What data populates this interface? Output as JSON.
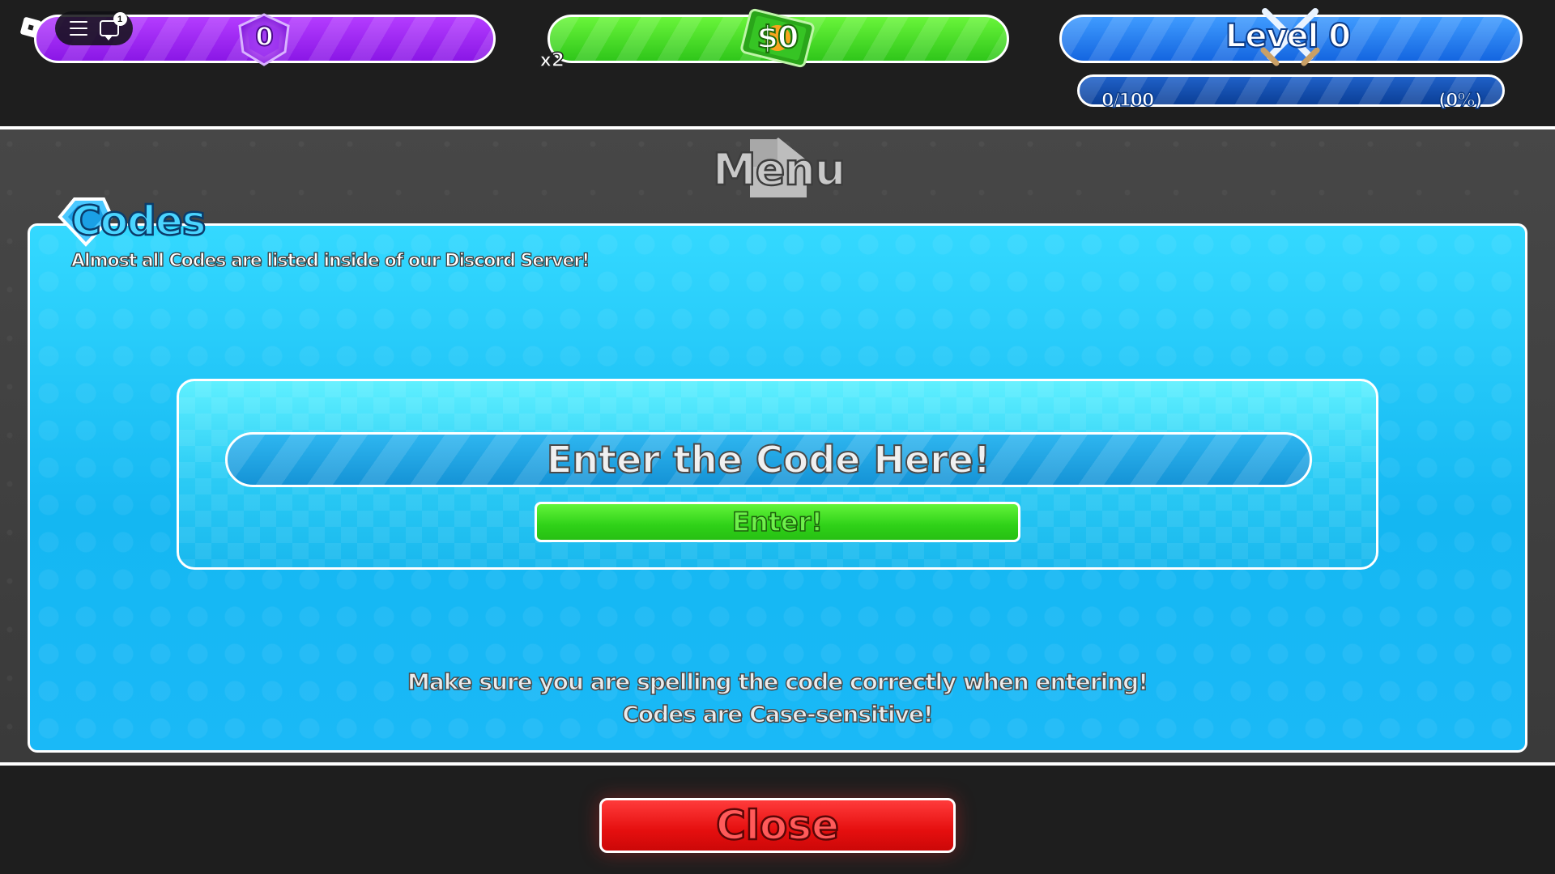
{
  "hud": {
    "gems": {
      "value": "0",
      "color": "#9b27f2"
    },
    "cash": {
      "value": "$0",
      "multiplier": "x2",
      "color": "#3fd624"
    },
    "level": {
      "label": "Level 0",
      "xp_text": "0/100",
      "xp_percent_text": "(0%)",
      "xp_progress": 0,
      "color": "#2a7ff0"
    },
    "chat_badge": "1"
  },
  "menu": {
    "title": "Menu"
  },
  "codes": {
    "title": "Codes",
    "subtitle": "Almost all Codes are listed inside of our Discord Server!",
    "input_placeholder": "Enter the Code Here!",
    "enter_label": "Enter!",
    "warning_line1": "Make sure you are spelling the code correctly when entering!",
    "warning_line2": "Codes are Case-sensitive!",
    "panel_color": "#1ab9f7"
  },
  "close_label": "Close",
  "icons": [
    "roblox-logo-icon",
    "hamburger-menu-icon",
    "chat-icon",
    "gem-icon",
    "cash-icon",
    "crossed-swords-icon",
    "codes-gem-icon"
  ]
}
